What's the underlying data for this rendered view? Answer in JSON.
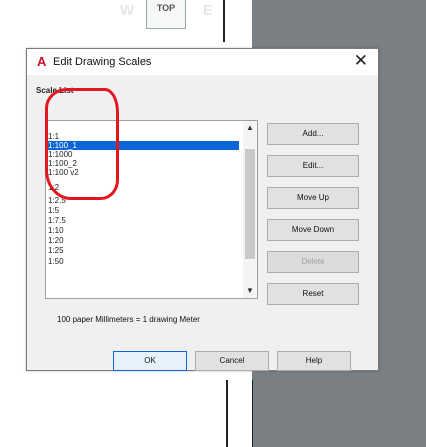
{
  "background": {
    "viewcube_label": "TOP",
    "ghost_letter_w": "W",
    "ghost_letter_e": "E"
  },
  "dialog": {
    "title": "Edit Drawing Scales",
    "app_icon_letter": "A",
    "close_glyph": "✕",
    "scale_list_label": "Scale List",
    "scale_items": [
      "1:1",
      "1:100_1",
      "1:1000",
      "1:100_2",
      "1:100 v2",
      "1:2",
      "1:2.5",
      "1:5",
      "1:7.5",
      "1:10",
      "1:20",
      "1:25",
      "1:50"
    ],
    "selected_index": 1,
    "buttons": {
      "add": "Add...",
      "edit": "Edit...",
      "move_up": "Move Up",
      "move_down": "Move Down",
      "delete": "Delete",
      "reset": "Reset",
      "ok": "OK",
      "cancel": "Cancel",
      "help": "Help"
    },
    "ratio_text": "100 paper Millimeters = 1 drawing Meter",
    "scroll_up_glyph": "▲",
    "scroll_down_glyph": "▼"
  },
  "colors": {
    "selection": "#0a66d6",
    "annotation": "#e4151f",
    "app_icon": "#c8102e"
  }
}
